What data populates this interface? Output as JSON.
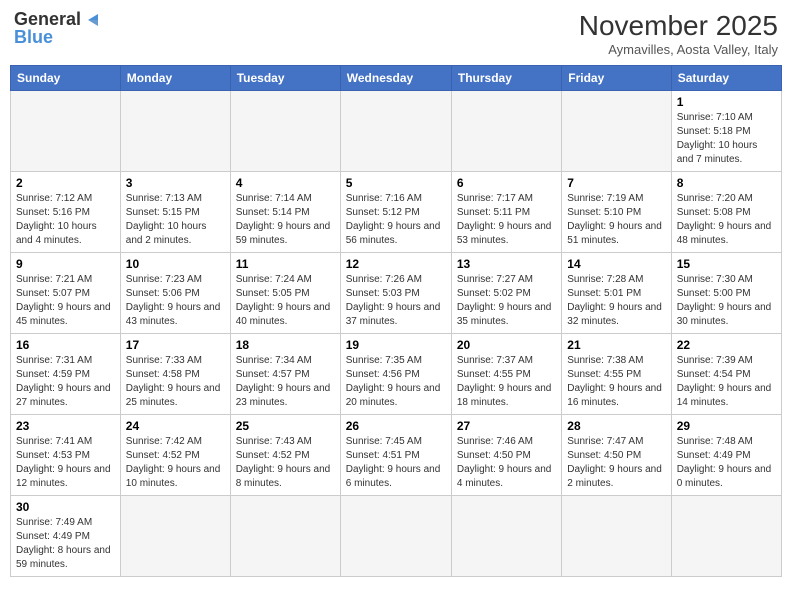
{
  "header": {
    "logo_general": "General",
    "logo_blue": "Blue",
    "month_title": "November 2025",
    "subtitle": "Aymavilles, Aosta Valley, Italy"
  },
  "days_of_week": [
    "Sunday",
    "Monday",
    "Tuesday",
    "Wednesday",
    "Thursday",
    "Friday",
    "Saturday"
  ],
  "weeks": [
    [
      {
        "day": "",
        "info": "",
        "empty": true
      },
      {
        "day": "",
        "info": "",
        "empty": true
      },
      {
        "day": "",
        "info": "",
        "empty": true
      },
      {
        "day": "",
        "info": "",
        "empty": true
      },
      {
        "day": "",
        "info": "",
        "empty": true
      },
      {
        "day": "",
        "info": "",
        "empty": true
      },
      {
        "day": "1",
        "info": "Sunrise: 7:10 AM\nSunset: 5:18 PM\nDaylight: 10 hours and 7 minutes."
      }
    ],
    [
      {
        "day": "2",
        "info": "Sunrise: 7:12 AM\nSunset: 5:16 PM\nDaylight: 10 hours and 4 minutes."
      },
      {
        "day": "3",
        "info": "Sunrise: 7:13 AM\nSunset: 5:15 PM\nDaylight: 10 hours and 2 minutes."
      },
      {
        "day": "4",
        "info": "Sunrise: 7:14 AM\nSunset: 5:14 PM\nDaylight: 9 hours and 59 minutes."
      },
      {
        "day": "5",
        "info": "Sunrise: 7:16 AM\nSunset: 5:12 PM\nDaylight: 9 hours and 56 minutes."
      },
      {
        "day": "6",
        "info": "Sunrise: 7:17 AM\nSunset: 5:11 PM\nDaylight: 9 hours and 53 minutes."
      },
      {
        "day": "7",
        "info": "Sunrise: 7:19 AM\nSunset: 5:10 PM\nDaylight: 9 hours and 51 minutes."
      },
      {
        "day": "8",
        "info": "Sunrise: 7:20 AM\nSunset: 5:08 PM\nDaylight: 9 hours and 48 minutes."
      }
    ],
    [
      {
        "day": "9",
        "info": "Sunrise: 7:21 AM\nSunset: 5:07 PM\nDaylight: 9 hours and 45 minutes."
      },
      {
        "day": "10",
        "info": "Sunrise: 7:23 AM\nSunset: 5:06 PM\nDaylight: 9 hours and 43 minutes."
      },
      {
        "day": "11",
        "info": "Sunrise: 7:24 AM\nSunset: 5:05 PM\nDaylight: 9 hours and 40 minutes."
      },
      {
        "day": "12",
        "info": "Sunrise: 7:26 AM\nSunset: 5:03 PM\nDaylight: 9 hours and 37 minutes."
      },
      {
        "day": "13",
        "info": "Sunrise: 7:27 AM\nSunset: 5:02 PM\nDaylight: 9 hours and 35 minutes."
      },
      {
        "day": "14",
        "info": "Sunrise: 7:28 AM\nSunset: 5:01 PM\nDaylight: 9 hours and 32 minutes."
      },
      {
        "day": "15",
        "info": "Sunrise: 7:30 AM\nSunset: 5:00 PM\nDaylight: 9 hours and 30 minutes."
      }
    ],
    [
      {
        "day": "16",
        "info": "Sunrise: 7:31 AM\nSunset: 4:59 PM\nDaylight: 9 hours and 27 minutes."
      },
      {
        "day": "17",
        "info": "Sunrise: 7:33 AM\nSunset: 4:58 PM\nDaylight: 9 hours and 25 minutes."
      },
      {
        "day": "18",
        "info": "Sunrise: 7:34 AM\nSunset: 4:57 PM\nDaylight: 9 hours and 23 minutes."
      },
      {
        "day": "19",
        "info": "Sunrise: 7:35 AM\nSunset: 4:56 PM\nDaylight: 9 hours and 20 minutes."
      },
      {
        "day": "20",
        "info": "Sunrise: 7:37 AM\nSunset: 4:55 PM\nDaylight: 9 hours and 18 minutes."
      },
      {
        "day": "21",
        "info": "Sunrise: 7:38 AM\nSunset: 4:55 PM\nDaylight: 9 hours and 16 minutes."
      },
      {
        "day": "22",
        "info": "Sunrise: 7:39 AM\nSunset: 4:54 PM\nDaylight: 9 hours and 14 minutes."
      }
    ],
    [
      {
        "day": "23",
        "info": "Sunrise: 7:41 AM\nSunset: 4:53 PM\nDaylight: 9 hours and 12 minutes."
      },
      {
        "day": "24",
        "info": "Sunrise: 7:42 AM\nSunset: 4:52 PM\nDaylight: 9 hours and 10 minutes."
      },
      {
        "day": "25",
        "info": "Sunrise: 7:43 AM\nSunset: 4:52 PM\nDaylight: 9 hours and 8 minutes."
      },
      {
        "day": "26",
        "info": "Sunrise: 7:45 AM\nSunset: 4:51 PM\nDaylight: 9 hours and 6 minutes."
      },
      {
        "day": "27",
        "info": "Sunrise: 7:46 AM\nSunset: 4:50 PM\nDaylight: 9 hours and 4 minutes."
      },
      {
        "day": "28",
        "info": "Sunrise: 7:47 AM\nSunset: 4:50 PM\nDaylight: 9 hours and 2 minutes."
      },
      {
        "day": "29",
        "info": "Sunrise: 7:48 AM\nSunset: 4:49 PM\nDaylight: 9 hours and 0 minutes."
      }
    ],
    [
      {
        "day": "30",
        "info": "Sunrise: 7:49 AM\nSunset: 4:49 PM\nDaylight: 8 hours and 59 minutes."
      },
      {
        "day": "",
        "info": "",
        "empty": true
      },
      {
        "day": "",
        "info": "",
        "empty": true
      },
      {
        "day": "",
        "info": "",
        "empty": true
      },
      {
        "day": "",
        "info": "",
        "empty": true
      },
      {
        "day": "",
        "info": "",
        "empty": true
      },
      {
        "day": "",
        "info": "",
        "empty": true
      }
    ]
  ]
}
